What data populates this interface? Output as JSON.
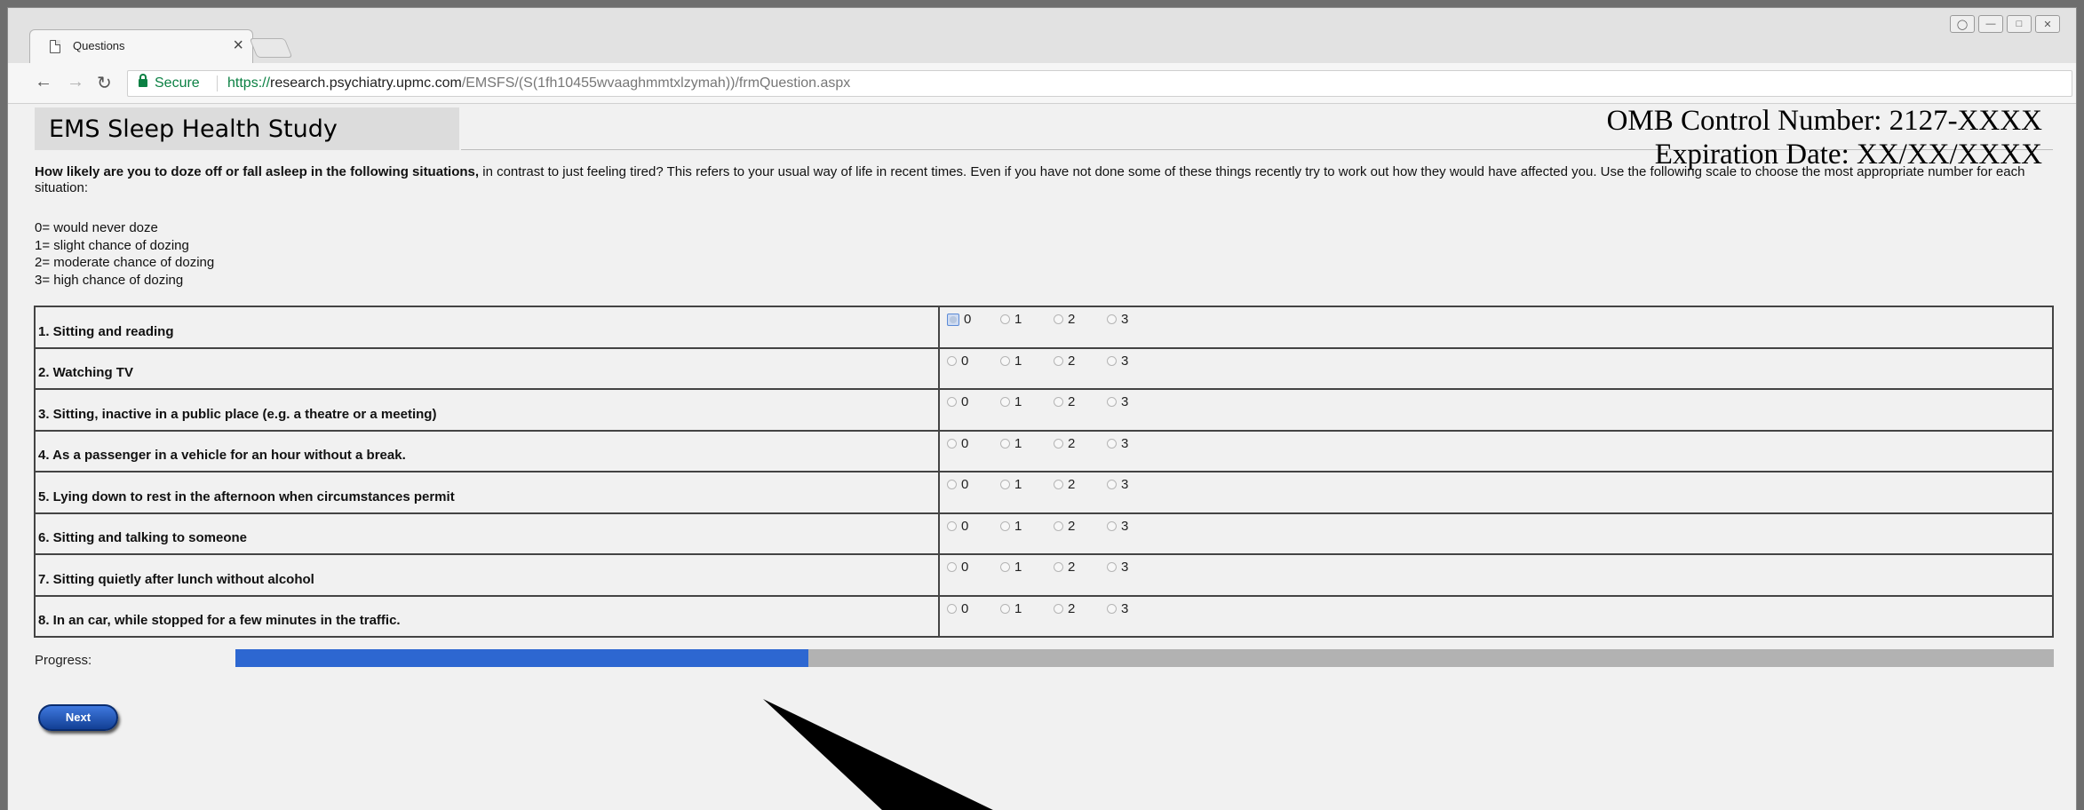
{
  "browser": {
    "tab_title": "Questions",
    "tab_close": "×",
    "secure_label": "Secure",
    "url_scheme": "https://",
    "url_host": "research.psychiatry.upmc.com",
    "url_path": "/EMSFS/(S(1fh10455wvaaghmmtxlzymah))/frmQuestion.aspx"
  },
  "header": {
    "omb_line": "OMB Control Number: 2127-XXXX",
    "expiration_line": "Expiration Date:  XX/XX/XXXX",
    "study_title": "EMS Sleep Health Study"
  },
  "instructions": {
    "bold": "How likely are you to doze off or fall asleep in the following situations,",
    "rest": " in contrast to just feeling tired? This refers to your usual way of life in recent times. Even if you have not done some of these things recently try to work out how they would have affected you. Use the following scale to choose the most appropriate number for each situation:",
    "scale": [
      "0= would never doze",
      "1= slight chance of dozing",
      "2= moderate chance of dozing",
      "3= high chance of dozing"
    ]
  },
  "questions": [
    "1. Sitting and reading",
    "2. Watching TV",
    "3. Sitting, inactive in a public place (e.g. a theatre or a meeting)",
    "4. As a passenger in a vehicle for an hour without a break.",
    "5. Lying down to rest in the afternoon when circumstances permit",
    "6. Sitting and talking to someone",
    "7. Sitting quietly after lunch without alcohol",
    "8. In an car, while stopped for a few minutes in the traffic."
  ],
  "options": [
    "0",
    "1",
    "2",
    "3"
  ],
  "progress": {
    "label": "Progress:",
    "fraction": 0.315
  },
  "next_label": "Next",
  "colors": {
    "progress_fill": "#2d67d1",
    "progress_track": "#b2b2b2",
    "secure": "#0b8043"
  }
}
